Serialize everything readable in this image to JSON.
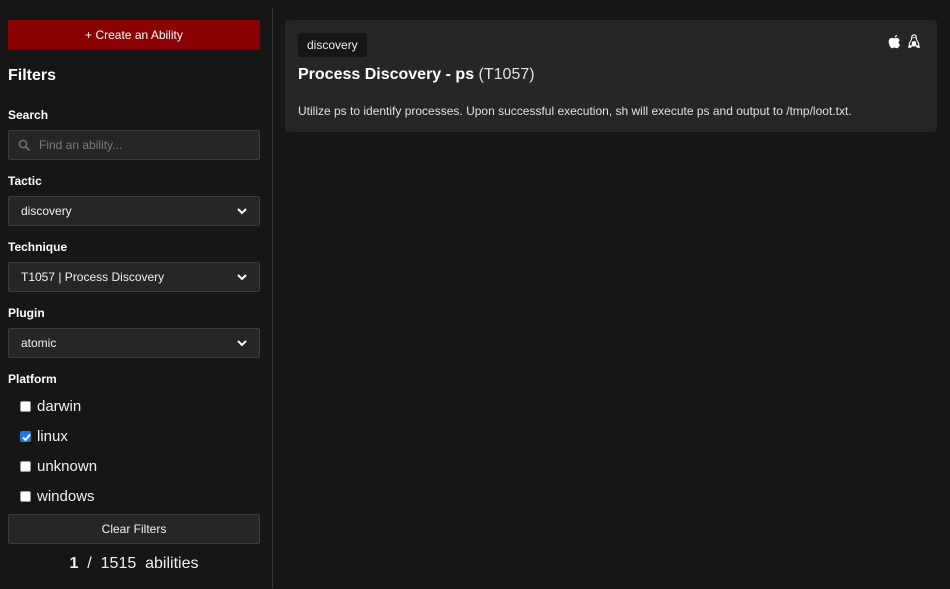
{
  "sidebar": {
    "create_button": "+ Create an Ability",
    "filters_title": "Filters",
    "search": {
      "label": "Search",
      "placeholder": "Find an ability...",
      "value": ""
    },
    "tactic": {
      "label": "Tactic",
      "value": "discovery"
    },
    "technique": {
      "label": "Technique",
      "value": "T1057 | Process Discovery"
    },
    "plugin": {
      "label": "Plugin",
      "value": "atomic"
    },
    "platform": {
      "label": "Platform",
      "options": [
        {
          "label": "darwin",
          "checked": false
        },
        {
          "label": "linux",
          "checked": true
        },
        {
          "label": "unknown",
          "checked": false
        },
        {
          "label": "windows",
          "checked": false
        }
      ]
    },
    "clear_button": "Clear Filters",
    "count": {
      "shown": "1",
      "separator": "/",
      "total": "1515",
      "unit": "abilities"
    }
  },
  "results": [
    {
      "tag": "discovery",
      "name": "Process Discovery - ps",
      "technique_id": "(T1057)",
      "description": "Utilize ps to identify processes. Upon successful execution, sh will execute ps and output to /tmp/loot.txt.",
      "platform_icons": [
        "apple-icon",
        "linux-icon"
      ]
    }
  ],
  "colors": {
    "background": "#161616",
    "panel": "#262626",
    "accent_button": "#8b0000",
    "checkbox_checked": "#2a73d9"
  }
}
